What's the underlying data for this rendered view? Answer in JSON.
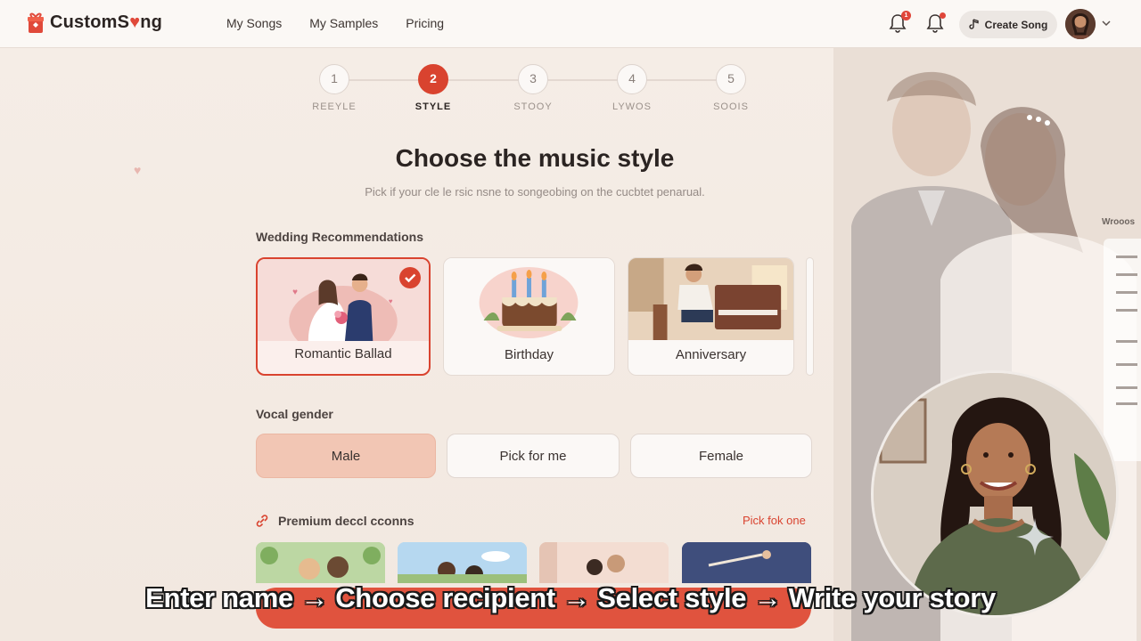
{
  "app": {
    "name_left": "CustomS",
    "name_heart": "♥",
    "name_right": "ng"
  },
  "nav": {
    "items": [
      "My Songs",
      "My Samples",
      "Pricing"
    ]
  },
  "header": {
    "notif_count": "1",
    "create_label": "Create Song"
  },
  "stepper": {
    "steps": [
      {
        "num": "1",
        "label": "REEYLE"
      },
      {
        "num": "2",
        "label": "STYLE"
      },
      {
        "num": "3",
        "label": "STOOY"
      },
      {
        "num": "4",
        "label": "LYWOS"
      },
      {
        "num": "5",
        "label": "SOOIS"
      }
    ],
    "active_index": 1
  },
  "page": {
    "title": "Choose the music style",
    "subtitle": "Pick if your cle le rsic nsne to songeobing on the cucbtet penarual."
  },
  "recommendations": {
    "label": "Wedding Recommendations",
    "cards": [
      {
        "label": "Romantic Ballad",
        "selected": true
      },
      {
        "label": "Birthday",
        "selected": false
      },
      {
        "label": "Anniversary",
        "selected": false
      }
    ]
  },
  "vocal": {
    "label": "Vocal gender",
    "options": [
      "Male",
      "Pick for me",
      "Female"
    ],
    "selected": "Male"
  },
  "premium": {
    "label": "Premium deccl cconns",
    "link": "Pick fok one"
  },
  "side_panel": {
    "heading": "Wrooos"
  },
  "caption": "Enter name → Choose recipient → Select style → Write your story",
  "colors": {
    "accent": "#d9432f",
    "selected_fill": "#f2c6b4"
  }
}
